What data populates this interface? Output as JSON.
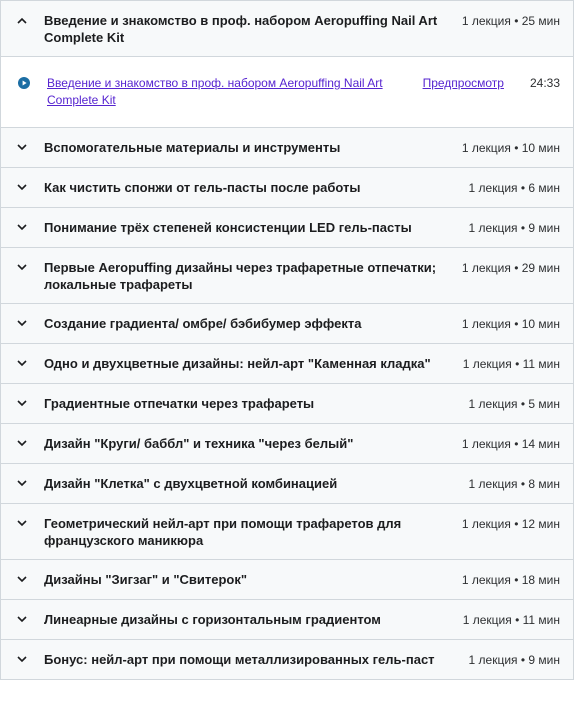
{
  "sections": [
    {
      "title": "Введение и знакомство в проф. набором Aeropuffing Nail Art Complete Kit",
      "meta": "1 лекция • 25 мин",
      "expanded": true,
      "lectures": [
        {
          "title": "Введение и знакомство в проф. набором Aeropuffing Nail Art Complete Kit",
          "preview": "Предпросмотр",
          "duration": "24:33",
          "icon": "play-circle-icon"
        }
      ]
    },
    {
      "title": "Вспомогательные материалы и инструменты",
      "meta": "1 лекция • 10 мин",
      "expanded": false
    },
    {
      "title": "Как чистить спонжи от гель-пасты после работы",
      "meta": "1 лекция • 6 мин",
      "expanded": false
    },
    {
      "title": "Понимание трёх степеней консистенции LED гель-пасты",
      "meta": "1 лекция • 9 мин",
      "expanded": false
    },
    {
      "title": "Первые Aeropuffing дизайны через трафаретные отпечатки; локальные трафареты",
      "meta": "1 лекция • 29 мин",
      "expanded": false
    },
    {
      "title": "Создание градиента/ омбре/ бэбибумер эффекта",
      "meta": "1 лекция • 10 мин",
      "expanded": false
    },
    {
      "title": "Одно и двухцветные дизайны: нейл-арт \"Каменная кладка\"",
      "meta": "1 лекция • 11 мин",
      "expanded": false
    },
    {
      "title": "Градиентные отпечатки через трафареты",
      "meta": "1 лекция • 5 мин",
      "expanded": false
    },
    {
      "title": "Дизайн \"Круги/ баббл\" и техника \"через белый\"",
      "meta": "1 лекция • 14 мин",
      "expanded": false
    },
    {
      "title": "Дизайн \"Клетка\" с двухцветной комбинацией",
      "meta": "1 лекция • 8 мин",
      "expanded": false
    },
    {
      "title": "Геометрический нейл-арт при помощи трафаретов для французского маникюра",
      "meta": "1 лекция • 12 мин",
      "expanded": false
    },
    {
      "title": "Дизайны \"Зигзаг\" и \"Свитерок\"",
      "meta": "1 лекция • 18 мин",
      "expanded": false
    },
    {
      "title": "Линеарные дизайны с горизонтальным градиентом",
      "meta": "1 лекция • 11 мин",
      "expanded": false
    },
    {
      "title": "Бонус: нейл-арт при помощи металлизированных гель-паст",
      "meta": "1 лекция • 9 мин",
      "expanded": false
    }
  ],
  "icons": {
    "expanded": "chevron-up-icon",
    "collapsed": "chevron-down-icon",
    "lecture": "play-circle-icon"
  },
  "colors": {
    "link": "#5624d0",
    "header_bg": "#f7f9fa",
    "border": "#d1d7dc",
    "text": "#1c1d1f"
  }
}
